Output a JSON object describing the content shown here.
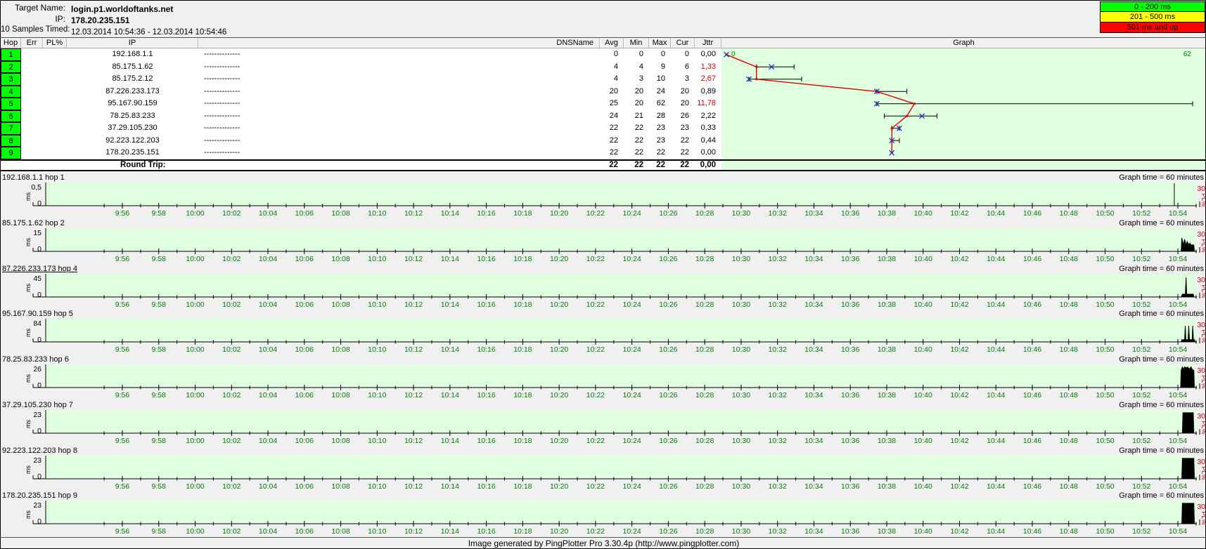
{
  "header": {
    "target_name_label": "Target Name:",
    "target_name": "login.p1.worldoftanks.net",
    "ip_label": "IP:",
    "ip": "178.20.235.151",
    "samples_label": "10 Samples Timed:",
    "samples_value": "12.03.2014 10:54:36 - 12.03.2014 10:54:46"
  },
  "legend": [
    {
      "label": "0 - 200 ms",
      "color": "#00FF00"
    },
    {
      "label": "201 - 500 ms",
      "color": "#FFFF00"
    },
    {
      "label": "501 ms and up",
      "color": "#FF0000"
    }
  ],
  "table": {
    "columns": [
      "Hop",
      "Err",
      "PL%",
      "IP",
      "DNSName",
      "Avg",
      "Min",
      "Max",
      "Cur",
      "Jttr",
      "Graph"
    ],
    "rows": [
      {
        "hop": "1",
        "err": "",
        "pl": "",
        "ip": "192.168.1.1",
        "dns": "--------------",
        "avg": "0",
        "min": "0",
        "max": "0",
        "cur": "0",
        "jttr": "0,00",
        "jttr_red": false
      },
      {
        "hop": "2",
        "err": "",
        "pl": "",
        "ip": "85.175.1.62",
        "dns": "--------------",
        "avg": "4",
        "min": "4",
        "max": "9",
        "cur": "6",
        "jttr": "1,33",
        "jttr_red": true
      },
      {
        "hop": "3",
        "err": "",
        "pl": "",
        "ip": "85.175.2.12",
        "dns": "--------------",
        "avg": "4",
        "min": "3",
        "max": "10",
        "cur": "3",
        "jttr": "2,67",
        "jttr_red": true
      },
      {
        "hop": "4",
        "err": "",
        "pl": "",
        "ip": "87.226.233.173",
        "dns": "--------------",
        "avg": "20",
        "min": "20",
        "max": "24",
        "cur": "20",
        "jttr": "0,89",
        "jttr_red": false
      },
      {
        "hop": "5",
        "err": "",
        "pl": "",
        "ip": "95.167.90.159",
        "dns": "--------------",
        "avg": "25",
        "min": "20",
        "max": "62",
        "cur": "20",
        "jttr": "11,78",
        "jttr_red": true
      },
      {
        "hop": "6",
        "err": "",
        "pl": "",
        "ip": "78.25.83.233",
        "dns": "--------------",
        "avg": "24",
        "min": "21",
        "max": "28",
        "cur": "26",
        "jttr": "2,22",
        "jttr_red": false
      },
      {
        "hop": "7",
        "err": "",
        "pl": "",
        "ip": "37.29.105.230",
        "dns": "--------------",
        "avg": "22",
        "min": "22",
        "max": "23",
        "cur": "23",
        "jttr": "0,33",
        "jttr_red": false
      },
      {
        "hop": "8",
        "err": "",
        "pl": "",
        "ip": "92.223.122.203",
        "dns": "--------------",
        "avg": "22",
        "min": "22",
        "max": "23",
        "cur": "22",
        "jttr": "0,44",
        "jttr_red": false
      },
      {
        "hop": "9",
        "err": "",
        "pl": "",
        "ip": "178.20.235.151",
        "dns": "--------------",
        "avg": "22",
        "min": "22",
        "max": "22",
        "cur": "22",
        "jttr": "0,00",
        "jttr_red": false
      }
    ],
    "round_trip": {
      "label": "Round Trip:",
      "avg": "22",
      "min": "22",
      "max": "22",
      "cur": "22",
      "jttr": "0,00"
    }
  },
  "chart_data": {
    "main_graph": {
      "type": "scatter",
      "x_axis": "latency ms per hop (red line = Avg, blue x = Cur, black bar = Min-Max)",
      "xlim": [
        0,
        62
      ],
      "x_min_label": "0",
      "x_max_label": "62",
      "line_color": "#E00000",
      "marker_color": "#3232C8",
      "bg_color": "#DFFFDF",
      "hops": [
        {
          "hop": 1,
          "avg": 0,
          "min": 0,
          "max": 0,
          "cur": 0
        },
        {
          "hop": 2,
          "avg": 4,
          "min": 4,
          "max": 9,
          "cur": 6
        },
        {
          "hop": 3,
          "avg": 4,
          "min": 3,
          "max": 10,
          "cur": 3
        },
        {
          "hop": 4,
          "avg": 20,
          "min": 20,
          "max": 24,
          "cur": 20
        },
        {
          "hop": 5,
          "avg": 25,
          "min": 20,
          "max": 62,
          "cur": 20
        },
        {
          "hop": 6,
          "avg": 24,
          "min": 21,
          "max": 28,
          "cur": 26
        },
        {
          "hop": 7,
          "avg": 22,
          "min": 22,
          "max": 23,
          "cur": 23
        },
        {
          "hop": 8,
          "avg": 22,
          "min": 22,
          "max": 23,
          "cur": 22
        },
        {
          "hop": 9,
          "avg": 22,
          "min": 22,
          "max": 22,
          "cur": 22
        }
      ]
    },
    "timelines": {
      "type": "line",
      "graph_time_label": "Graph time = 60 minutes",
      "y_unit": "ms",
      "y_zero_label": "0",
      "pl_max_label": "30",
      "pl_label": "PL%",
      "tick_color": "#008000",
      "x_ticks": [
        "9:56",
        "9:58",
        "10:00",
        "10:02",
        "10:04",
        "10:06",
        "10:08",
        "10:10",
        "10:12",
        "10:14",
        "10:16",
        "10:18",
        "10:20",
        "10:22",
        "10:24",
        "10:26",
        "10:28",
        "10:30",
        "10:32",
        "10:34",
        "10:36",
        "10:38",
        "10:40",
        "10:42",
        "10:44",
        "10:46",
        "10:48",
        "10:50",
        "10:52",
        "10:54"
      ],
      "strips": [
        {
          "label": "192.168.1.1 hop 1",
          "y_max_label": "0,5",
          "underline": false,
          "marker": true,
          "trace": []
        },
        {
          "label": "85.175.1.62 hop 2",
          "y_max_label": "15",
          "underline": false,
          "marker": false,
          "trace": [
            [
              0.987,
              0
            ],
            [
              0.9875,
              0.62
            ],
            [
              0.989,
              0.28
            ],
            [
              0.99,
              0.55
            ],
            [
              0.9912,
              0.28
            ],
            [
              0.9922,
              0.45
            ],
            [
              0.9934,
              0.3
            ],
            [
              0.9945,
              0.38
            ],
            [
              0.9958,
              0.28
            ],
            [
              0.997,
              0.3
            ],
            [
              0.998,
              0.28
            ],
            [
              0.9985,
              0
            ]
          ]
        },
        {
          "label": "87.226.233.173 hop 4",
          "y_max_label": "45",
          "underline": true,
          "marker": false,
          "trace": [
            [
              0.987,
              0
            ],
            [
              0.988,
              0.13
            ],
            [
              0.9906,
              0.13
            ],
            [
              0.9912,
              0.9
            ],
            [
              0.9918,
              0.13
            ],
            [
              0.9975,
              0.13
            ],
            [
              0.998,
              0
            ]
          ]
        },
        {
          "label": "95.167.90.159 hop 5",
          "y_max_label": "84",
          "underline": false,
          "marker": false,
          "trace": [
            [
              0.987,
              0
            ],
            [
              0.9875,
              0.1
            ],
            [
              0.99,
              0.1
            ],
            [
              0.9905,
              0.74
            ],
            [
              0.9911,
              0.1
            ],
            [
              0.993,
              0.1
            ],
            [
              0.9936,
              0.74
            ],
            [
              0.9942,
              0.1
            ],
            [
              0.9965,
              0.1
            ],
            [
              0.997,
              0.74
            ],
            [
              0.9976,
              0.1
            ],
            [
              0.9985,
              0.1
            ],
            [
              0.999,
              0
            ]
          ]
        },
        {
          "label": "78.25.83.233 hop 6",
          "y_max_label": "26",
          "underline": false,
          "marker": false,
          "trace": [
            [
              0.9865,
              0
            ],
            [
              0.987,
              0.8
            ],
            [
              0.988,
              0.95
            ],
            [
              0.989,
              0.85
            ],
            [
              0.99,
              0.95
            ],
            [
              0.9915,
              0.9
            ],
            [
              0.9925,
              0.95
            ],
            [
              0.994,
              0.85
            ],
            [
              0.9955,
              0.95
            ],
            [
              0.997,
              0.8
            ],
            [
              0.998,
              0.8
            ],
            [
              0.9985,
              0
            ]
          ]
        },
        {
          "label": "37.29.105.230 hop 7",
          "y_max_label": "23",
          "underline": false,
          "marker": false,
          "trace": [
            [
              0.988,
              0
            ],
            [
              0.9885,
              0.94
            ],
            [
              0.9975,
              0.94
            ],
            [
              0.998,
              0
            ]
          ]
        },
        {
          "label": "92.223.122.203 hop 8",
          "y_max_label": "23",
          "underline": false,
          "marker": false,
          "trace": [
            [
              0.9875,
              0
            ],
            [
              0.988,
              0.94
            ],
            [
              0.998,
              0.94
            ],
            [
              0.9985,
              0
            ]
          ]
        },
        {
          "label": "178.20.235.151 hop 9",
          "y_max_label": "23",
          "underline": false,
          "marker": false,
          "trace": [
            [
              0.9875,
              0
            ],
            [
              0.988,
              0.94
            ],
            [
              0.998,
              0.94
            ],
            [
              0.9985,
              0
            ]
          ]
        }
      ]
    }
  },
  "footer": "Image generated by PingPlotter Pro 3.30.4p (http://www.pingplotter.com)"
}
